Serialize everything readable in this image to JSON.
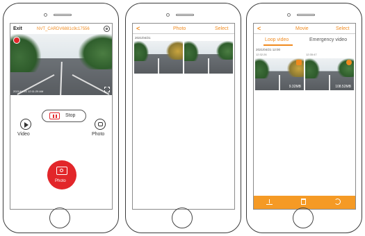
{
  "screen1": {
    "exit": "Exit",
    "ssid": "NVT_CARDV6881c9c17556",
    "timestamp": "2021/04/21 12:11:29 AM",
    "stop": "Stop",
    "video": "Video",
    "photo": "Photo",
    "shutter_label": "Photo",
    "icons": [
      "settings-icon",
      "record-indicator-icon",
      "fullscreen-icon",
      "record-stop-icon",
      "play-icon",
      "photo-small-icon",
      "camera-icon"
    ]
  },
  "screen2": {
    "back": "<",
    "title": "Photo",
    "select": "Select",
    "date": "2021/04/21"
  },
  "screen3": {
    "back": "<",
    "title": "Movie",
    "select": "Select",
    "tabs": [
      "Loop video",
      "Emergency video"
    ],
    "date": "2021/04/21 12:00",
    "items": [
      {
        "time": "12:32:26",
        "size": "9.32MB"
      },
      {
        "time": "12:35:47",
        "size": "108.52MB"
      }
    ],
    "toolbar_icons": [
      "download-icon",
      "trash-icon",
      "undo-icon"
    ]
  },
  "colors": {
    "accent": "#f08a1e",
    "shutter": "#e2262a",
    "toolbar": "#f59a25"
  }
}
